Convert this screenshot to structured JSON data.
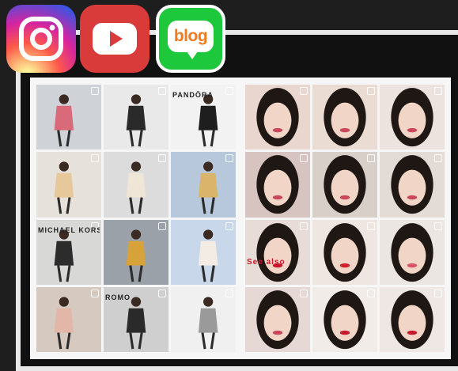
{
  "icons": {
    "instagram": "instagram-icon",
    "youtube": "youtube-icon",
    "blog": "blog-icon",
    "blog_label": "blog"
  },
  "left_grid": {
    "tiles": [
      {
        "bg": "#cfd3d8",
        "fg": "#d86a7a",
        "caption": ""
      },
      {
        "bg": "#e9e9ea",
        "fg": "#2a2a2a",
        "caption": ""
      },
      {
        "bg": "#f2f2f2",
        "fg": "#1e1e1e",
        "caption": "PANDÔRA"
      },
      {
        "bg": "#e6e1da",
        "fg": "#e7c89a",
        "caption": ""
      },
      {
        "bg": "#dcdcdc",
        "fg": "#f0e6d8",
        "caption": ""
      },
      {
        "bg": "#b8c8dc",
        "fg": "#d9b46a",
        "caption": ""
      },
      {
        "bg": "#d8d8d6",
        "fg": "#2c2c2c",
        "caption": "MICHAEL KORS"
      },
      {
        "bg": "#9aa1a8",
        "fg": "#d8a23a",
        "caption": ""
      },
      {
        "bg": "#c8d8ea",
        "fg": "#f2ece4",
        "caption": ""
      },
      {
        "bg": "#d6c9c0",
        "fg": "#e3b7a8",
        "caption": ""
      },
      {
        "bg": "#cfcfcf",
        "fg": "#2a2a2a",
        "caption": "ROMO"
      },
      {
        "bg": "#f0f0f0",
        "fg": "#9a9a9a",
        "caption": ""
      }
    ]
  },
  "right_grid": {
    "tiles": [
      {
        "bg": "#e9d6cf",
        "fg": "#2a1f1c",
        "caption": ""
      },
      {
        "bg": "#eadbd3",
        "fg": "#2a1f1c",
        "caption": ""
      },
      {
        "bg": "#ece3de",
        "fg": "#2a1f1c",
        "caption": ""
      },
      {
        "bg": "#d7c4c0",
        "fg": "#1c1c22",
        "caption": ""
      },
      {
        "bg": "#d9cfc9",
        "fg": "#2a1f1c",
        "caption": ""
      },
      {
        "bg": "#e3dcd6",
        "fg": "#2a1f1c",
        "caption": ""
      },
      {
        "bg": "#e8dcd8",
        "fg": "#c8182c",
        "caption": "See also"
      },
      {
        "bg": "#efe6e2",
        "fg": "#d0202e",
        "caption": ""
      },
      {
        "bg": "#ece6e2",
        "fg": "#d9536a",
        "caption": ""
      },
      {
        "bg": "#e6d8d4",
        "fg": "#2a1f1c",
        "caption": ""
      },
      {
        "bg": "#f2ece8",
        "fg": "#c8182c",
        "caption": ""
      },
      {
        "bg": "#efe7e3",
        "fg": "#c8182c",
        "caption": ""
      }
    ]
  }
}
